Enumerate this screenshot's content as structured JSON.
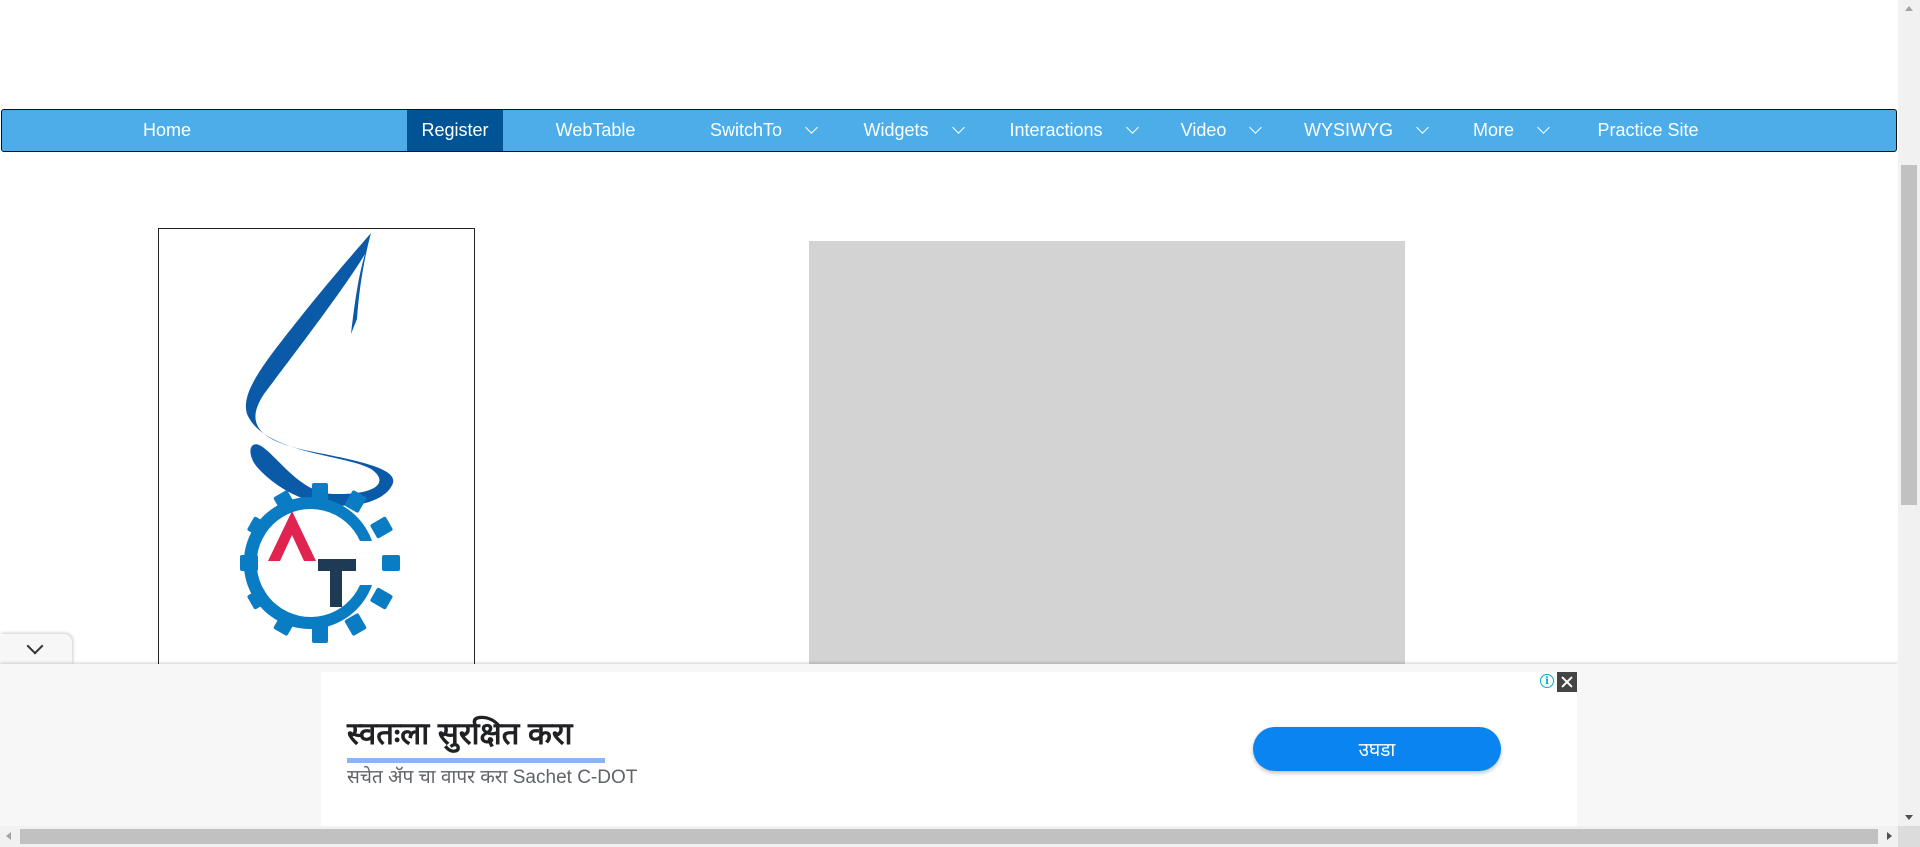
{
  "nav": {
    "items": [
      {
        "label": "Home",
        "dropdown": false,
        "active": false
      },
      {
        "label": "Register",
        "dropdown": false,
        "active": true
      },
      {
        "label": "WebTable",
        "dropdown": false,
        "active": false
      },
      {
        "label": "SwitchTo",
        "dropdown": true,
        "active": false
      },
      {
        "label": "Widgets",
        "dropdown": true,
        "active": false
      },
      {
        "label": "Interactions",
        "dropdown": true,
        "active": false
      },
      {
        "label": "Video",
        "dropdown": true,
        "active": false
      },
      {
        "label": "WYSIWYG",
        "dropdown": true,
        "active": false
      },
      {
        "label": "More",
        "dropdown": true,
        "active": false
      },
      {
        "label": "Practice Site",
        "dropdown": false,
        "active": false
      }
    ]
  },
  "colors": {
    "nav_bg": "#4cade9",
    "nav_active": "#005495",
    "logo_blue": "#0a5aa8",
    "logo_red": "#e0234f",
    "logo_navy": "#1f3a55",
    "ad_button": "#0a84f0"
  },
  "logo_panel": {
    "top_logo": "selenium-s-logo",
    "bottom_logo": "automation-testing-gear-logo"
  },
  "ad": {
    "title": "स्वतःला सुरक्षित करा",
    "subtitle": "सचेत ॲप चा वापर करा Sachet C-DOT",
    "cta_label": "उघडा",
    "info_icon": "info-icon",
    "close_icon": "close-icon",
    "toggle_icon": "chevron-down-icon"
  }
}
